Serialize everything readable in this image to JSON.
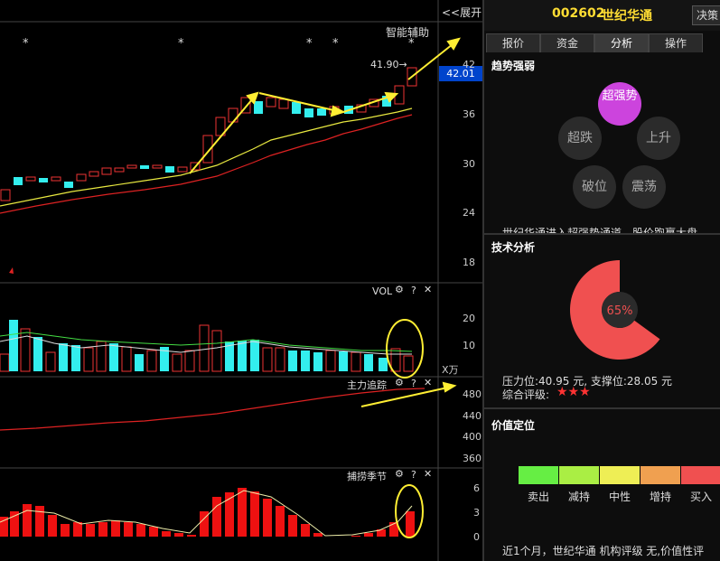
{
  "header": {
    "expand_label": "<<展开",
    "stock_code": "002602",
    "stock_name": "世纪华通",
    "decision_label": "决策"
  },
  "tabs": [
    {
      "label": "报价",
      "active": false
    },
    {
      "label": "资金",
      "active": false
    },
    {
      "label": "分析",
      "active": true
    },
    {
      "label": "操作",
      "active": false
    }
  ],
  "main_chart": {
    "assist_label": "智能辅助",
    "high_annotation": "41.90→",
    "current_price": "42.01",
    "price_ticks": [
      "42",
      "36",
      "30",
      "24",
      "18"
    ]
  },
  "vol_panel": {
    "label": "VOL",
    "ticks": [
      "20",
      "10"
    ],
    "unit": "X万"
  },
  "main_force_panel": {
    "label": "主力追踪",
    "ticks": [
      "480",
      "440",
      "400",
      "360"
    ]
  },
  "season_panel": {
    "label": "捕捞季节",
    "ticks": [
      "6",
      "3",
      "0"
    ]
  },
  "trend": {
    "title": "趋势强弱",
    "states": {
      "strong": "超强势",
      "plunge": "超跌",
      "rise": "上升",
      "break": "破位",
      "oscillate": "震荡"
    },
    "active_state": "超强势",
    "summary": "世纪华通进入超强势通道，股价跑赢大盘，"
  },
  "tech": {
    "title": "技术分析",
    "percent": 65,
    "percent_label": "65%",
    "support_resist": "压力位:40.95 元, 支撑位:28.05 元",
    "rating_label": "综合评级:",
    "rating_stars": "★★★",
    "donut_color": "#f05050"
  },
  "value": {
    "title": "价值定位",
    "levels": [
      "卖出",
      "减持",
      "中性",
      "增持",
      "买入"
    ],
    "level_colors": [
      "#66ee44",
      "#aaee44",
      "#eeee55",
      "#f0a050",
      "#f05050"
    ],
    "summary": "近1个月，世纪华通 机构评级 无,价值性评"
  }
}
